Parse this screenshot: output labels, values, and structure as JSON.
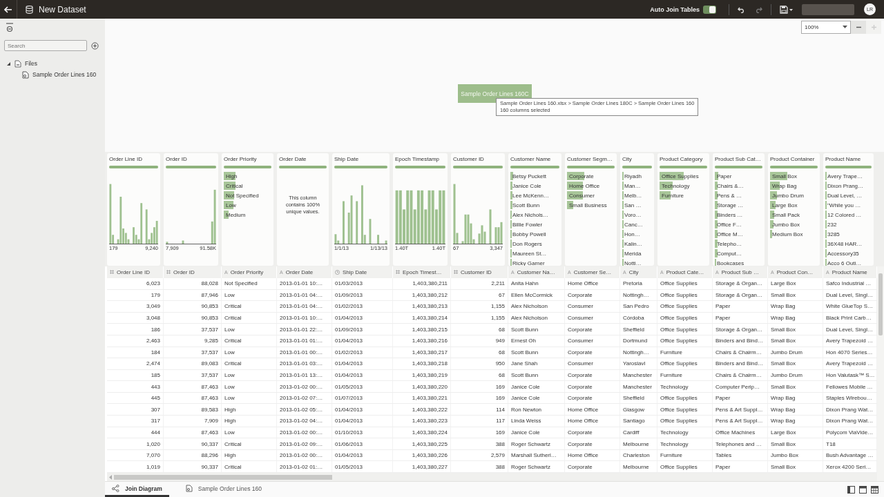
{
  "topbar": {
    "title": "New Dataset",
    "auto_join": {
      "label": "Auto Join Tables",
      "on": true
    },
    "undo": {
      "disabled": false
    },
    "redo": {
      "disabled": true
    },
    "avatar": "LR"
  },
  "sidebar": {
    "search": {
      "placeholder": "Search"
    },
    "tree": [
      {
        "label": "Files",
        "expanded": true,
        "children": [
          {
            "label": "Sample Order Lines 160"
          }
        ]
      }
    ]
  },
  "canvas": {
    "zoom": {
      "value": "100%"
    },
    "zoom_out": {
      "disabled": false
    },
    "zoom_in": {
      "disabled": true
    },
    "node": {
      "label": "Sample Order Lines 160C"
    },
    "tooltip": {
      "lines": [
        "Sample Order Lines 160.xlsx > Sample Order Lines 180C > Sample Order Lines 160",
        "160 columns selected"
      ]
    }
  },
  "profiles": [
    {
      "kind": "histogram",
      "title": "Order Line ID",
      "level": 1,
      "min": "179",
      "max": "9,240"
    },
    {
      "kind": "histogram",
      "title": "Order ID",
      "level": 1,
      "min": "7,909",
      "max": "91.58K"
    },
    {
      "kind": "categories",
      "title": "Order Priority",
      "level": 1,
      "items": [
        {
          "label": "High",
          "level": 0.25
        },
        {
          "label": "Critical",
          "level": 0.24
        },
        {
          "label": "Not Specified",
          "level": 0.22
        },
        {
          "label": "Low",
          "level": 0.2
        },
        {
          "label": "Medium",
          "level": 0.1
        }
      ]
    },
    {
      "kind": "unique",
      "title": "Order Date",
      "level": 1,
      "message": "This column contains 100% unique values."
    },
    {
      "kind": "histogram",
      "title": "Ship Date",
      "level": 1,
      "min": "1/1/13",
      "max": "1/13/13"
    },
    {
      "kind": "histogram",
      "title": "Epoch Timestamp",
      "level": 1,
      "min": "1.40T",
      "max": "1.40T"
    },
    {
      "kind": "histogram",
      "title": "Customer ID",
      "level": 1,
      "min": "67",
      "max": "3,347"
    },
    {
      "kind": "categories",
      "title": "Customer Name",
      "level": 1,
      "items": [
        {
          "label": "Betsy Puckett",
          "level": 0.05
        },
        {
          "label": "Janice Cole",
          "level": 0.04
        },
        {
          "label": "Lee McKenn…",
          "level": 0.04
        },
        {
          "label": "Scott Bunn",
          "level": 0.04
        },
        {
          "label": "Alex Nichols…",
          "level": 0.03
        },
        {
          "label": "Billie Fowler",
          "level": 0.03
        },
        {
          "label": "Bobby Powell",
          "level": 0.03
        },
        {
          "label": "Don Rogers",
          "level": 0.03
        },
        {
          "label": "Maureen St…",
          "level": 0.03
        },
        {
          "label": "Ricky Garner",
          "level": 0.03
        }
      ]
    },
    {
      "kind": "categories",
      "title": "Customer Segm…",
      "level": 1,
      "items": [
        {
          "label": "Corporate",
          "level": 0.36
        },
        {
          "label": "Home Office",
          "level": 0.34
        },
        {
          "label": "Consumer",
          "level": 0.33
        },
        {
          "label": "Small Business",
          "level": 0.13
        }
      ]
    },
    {
      "kind": "categories",
      "title": "City",
      "level": 1,
      "items": [
        {
          "label": "Riyadh",
          "level": 0.05
        },
        {
          "label": "Man…",
          "level": 0.05
        },
        {
          "label": "Melb…",
          "level": 0.05
        },
        {
          "label": "San …",
          "level": 0.05
        },
        {
          "label": "Voro…",
          "level": 0.05
        },
        {
          "label": "Canc…",
          "level": 0.05
        },
        {
          "label": "Hon…",
          "level": 0.05
        },
        {
          "label": "Kalin…",
          "level": 0.05
        },
        {
          "label": "Merida",
          "level": 0.05
        },
        {
          "label": "Notti…",
          "level": 0.05
        }
      ]
    },
    {
      "kind": "categories",
      "title": "Product Category",
      "level": 1,
      "items": [
        {
          "label": "Office Supplies",
          "level": 0.5
        },
        {
          "label": "Technology",
          "level": 0.27
        },
        {
          "label": "Furniture",
          "level": 0.23
        }
      ]
    },
    {
      "kind": "categories",
      "title": "Product Sub Cat…",
      "level": 1,
      "items": [
        {
          "label": "Paper",
          "level": 0.07
        },
        {
          "label": "Chairs &…",
          "level": 0.06
        },
        {
          "label": "Pens & …",
          "level": 0.06
        },
        {
          "label": "Storage …",
          "level": 0.06
        },
        {
          "label": "Binders …",
          "level": 0.06
        },
        {
          "label": "Office F…",
          "level": 0.06
        },
        {
          "label": "Office M…",
          "level": 0.06
        },
        {
          "label": "Telepho…",
          "level": 0.06
        },
        {
          "label": "Comput…",
          "level": 0.06
        },
        {
          "label": "Bookcases",
          "level": 0.02
        }
      ]
    },
    {
      "kind": "categories",
      "title": "Product Container",
      "level": 1,
      "items": [
        {
          "label": "Small Box",
          "level": 0.36
        },
        {
          "label": "Wrap Bag",
          "level": 0.2
        },
        {
          "label": "Jumbo Drum",
          "level": 0.14
        },
        {
          "label": "Large Box",
          "level": 0.12
        },
        {
          "label": "Small Pack",
          "level": 0.08
        },
        {
          "label": "Jumbo Box",
          "level": 0.07
        },
        {
          "label": "Medium Box",
          "level": 0.04
        }
      ]
    },
    {
      "kind": "categories",
      "title": "Product Name",
      "level": 1,
      "items": [
        {
          "label": "Avery Trape…",
          "level": 0.03
        },
        {
          "label": "Dixon Prang…",
          "level": 0.03
        },
        {
          "label": "Dual Level, …",
          "level": 0.03
        },
        {
          "label": "\"While you …",
          "level": 0.03
        },
        {
          "label": "12 Colored …",
          "level": 0.03
        },
        {
          "label": "232",
          "level": 0.03
        },
        {
          "label": "3285",
          "level": 0.03
        },
        {
          "label": "36X48 HAR…",
          "level": 0.03
        },
        {
          "label": "Accessory35",
          "level": 0.03
        },
        {
          "label": "Acco 6 Outi…",
          "level": 0.03
        }
      ]
    }
  ],
  "table": {
    "columns": [
      {
        "label": "Order Line ID",
        "kind": "number"
      },
      {
        "label": "Order ID",
        "kind": "number"
      },
      {
        "label": "Order Priority",
        "kind": "text",
        "glyph": "A"
      },
      {
        "label": "Order Date",
        "kind": "text",
        "glyph": "A"
      },
      {
        "label": "Ship Date",
        "kind": "date"
      },
      {
        "label": "Epoch Timest…",
        "kind": "number"
      },
      {
        "label": "Customer ID",
        "kind": "number"
      },
      {
        "label": "Customer Na…",
        "kind": "text",
        "glyph": "A"
      },
      {
        "label": "Customer Se…",
        "kind": "text",
        "glyph": "A"
      },
      {
        "label": "City",
        "kind": "text",
        "glyph": "A"
      },
      {
        "label": "Product Cate…",
        "kind": "text",
        "glyph": "A"
      },
      {
        "label": "Product Sub …",
        "kind": "text",
        "glyph": "A"
      },
      {
        "label": "Product Con…",
        "kind": "text",
        "glyph": "A"
      },
      {
        "label": "Product Name",
        "kind": "text",
        "glyph": "A"
      }
    ],
    "rows": [
      [
        "6,023",
        "88,028",
        "Not Specified",
        "2013-01-01 10:…",
        "01/03/2013",
        "1,403,380,211",
        "2,211",
        "Anita Hahn",
        "Home Office",
        "Pretoria",
        "Office Supplies",
        "Storage & Organ…",
        "Large Box",
        "Safco Industrial …"
      ],
      [
        "179",
        "87,946",
        "Low",
        "2013-01-01 04:…",
        "01/09/2013",
        "1,403,380,212",
        "67",
        "Ellen McCormick",
        "Corporate",
        "Nottingh…",
        "Office Supplies",
        "Storage & Organ…",
        "Small Box",
        "Dual Level, Singl…"
      ],
      [
        "3,049",
        "90,853",
        "Critical",
        "2013-01-01 04:…",
        "01/02/2013",
        "1,403,380,213",
        "1,155",
        "Alex Nicholson",
        "Consumer",
        "San Pedro",
        "Office Supplies",
        "Paper",
        "Wrap Bag",
        "White GlueTop S…"
      ],
      [
        "3,048",
        "90,853",
        "Critical",
        "2013-01-01 10:…",
        "01/04/2013",
        "1,403,380,214",
        "1,155",
        "Alex Nicholson",
        "Consumer",
        "Córdoba",
        "Office Supplies",
        "Paper",
        "Wrap Bag",
        "Black Print Carb…"
      ],
      [
        "186",
        "37,537",
        "Low",
        "2013-01-01 22:…",
        "01/09/2013",
        "1,403,380,215",
        "68",
        "Scott Bunn",
        "Corporate",
        "Sheffield",
        "Office Supplies",
        "Storage & Organ…",
        "Small Box",
        "Dual Level, Singl…"
      ],
      [
        "2,463",
        "9,285",
        "Critical",
        "2013-01-01 01:…",
        "01/04/2013",
        "1,403,380,216",
        "949",
        "Ernest Oh",
        "Consumer",
        "Dortmund",
        "Office Supplies",
        "Binders and Bind…",
        "Small Box",
        "Avery Trapezoid …"
      ],
      [
        "184",
        "37,537",
        "Low",
        "2013-01-01 00:…",
        "01/02/2013",
        "1,403,380,217",
        "68",
        "Scott Bunn",
        "Corporate",
        "Nottingh…",
        "Furniture",
        "Chairs & Chairm…",
        "Jumbo Drum",
        "Hon 4070 Series…"
      ],
      [
        "2,474",
        "89,083",
        "Critical",
        "2013-01-01 03:…",
        "01/04/2013",
        "1,403,380,218",
        "950",
        "Jane Shah",
        "Consumer",
        "Yaroslavl",
        "Office Supplies",
        "Binders and Bind…",
        "Small Box",
        "Avery Trapezoid …"
      ],
      [
        "185",
        "37,537",
        "Low",
        "2013-01-01 13:…",
        "01/04/2013",
        "1,403,380,219",
        "68",
        "Scott Bunn",
        "Corporate",
        "Manchester",
        "Furniture",
        "Chairs & Chairm…",
        "Jumbo Drum",
        "Hon Valutask™ S…"
      ],
      [
        "443",
        "87,463",
        "Low",
        "2013-01-02 00:…",
        "01/05/2013",
        "1,403,380,220",
        "169",
        "Janice Cole",
        "Corporate",
        "Manchester",
        "Technology",
        "Computer Perip…",
        "Small Box",
        "Fellowes Mobile …"
      ],
      [
        "445",
        "87,463",
        "Low",
        "2013-01-02 07:…",
        "01/07/2013",
        "1,403,380,221",
        "169",
        "Janice Cole",
        "Corporate",
        "Sheffield",
        "Office Supplies",
        "Paper",
        "Wrap Bag",
        "Staples Wirebou…"
      ],
      [
        "307",
        "89,583",
        "High",
        "2013-01-02 05:…",
        "01/04/2013",
        "1,403,380,222",
        "114",
        "Ron Newton",
        "Home Office",
        "Glasgow",
        "Office Supplies",
        "Pens & Art Suppl…",
        "Wrap Bag",
        "Dixon Prang Wat…"
      ],
      [
        "317",
        "7,909",
        "High",
        "2013-01-02 04:…",
        "01/04/2013",
        "1,403,380,223",
        "117",
        "Linda Weiss",
        "Home Office",
        "Santiago",
        "Office Supplies",
        "Pens & Art Suppl…",
        "Wrap Bag",
        "Dixon Prang Wat…"
      ],
      [
        "444",
        "87,463",
        "Low",
        "2013-01-02 00:…",
        "01/10/2013",
        "1,403,380,224",
        "169",
        "Janice Cole",
        "Corporate",
        "Cardiff",
        "Technology",
        "Office Machines",
        "Large Box",
        "Polycom ViaVide…"
      ],
      [
        "1,020",
        "90,337",
        "Critical",
        "2013-01-02 09:…",
        "01/06/2013",
        "1,403,380,225",
        "388",
        "Roger Schwartz",
        "Corporate",
        "Melbourne",
        "Technology",
        "Telephones and …",
        "Small Box",
        "T18"
      ],
      [
        "7,070",
        "88,296",
        "High",
        "2013-01-02 00:…",
        "01/04/2013",
        "1,403,380,226",
        "2,579",
        "Marshall Sutherl…",
        "Home Office",
        "Charleston",
        "Furniture",
        "Tables",
        "Jumbo Box",
        "Bush Advantage …"
      ],
      [
        "1,019",
        "90,337",
        "Critical",
        "2013-01-02 01:…",
        "01/05/2013",
        "1,403,380,227",
        "388",
        "Roger Schwartz",
        "Corporate",
        "Melbourne",
        "Office Supplies",
        "Paper",
        "Small Box",
        "Xerox 4200 Seri…"
      ]
    ]
  },
  "bottom_tabs": [
    {
      "label": "Join Diagram",
      "selected": true
    },
    {
      "label": "Sample Order Lines 160",
      "selected": false
    }
  ]
}
